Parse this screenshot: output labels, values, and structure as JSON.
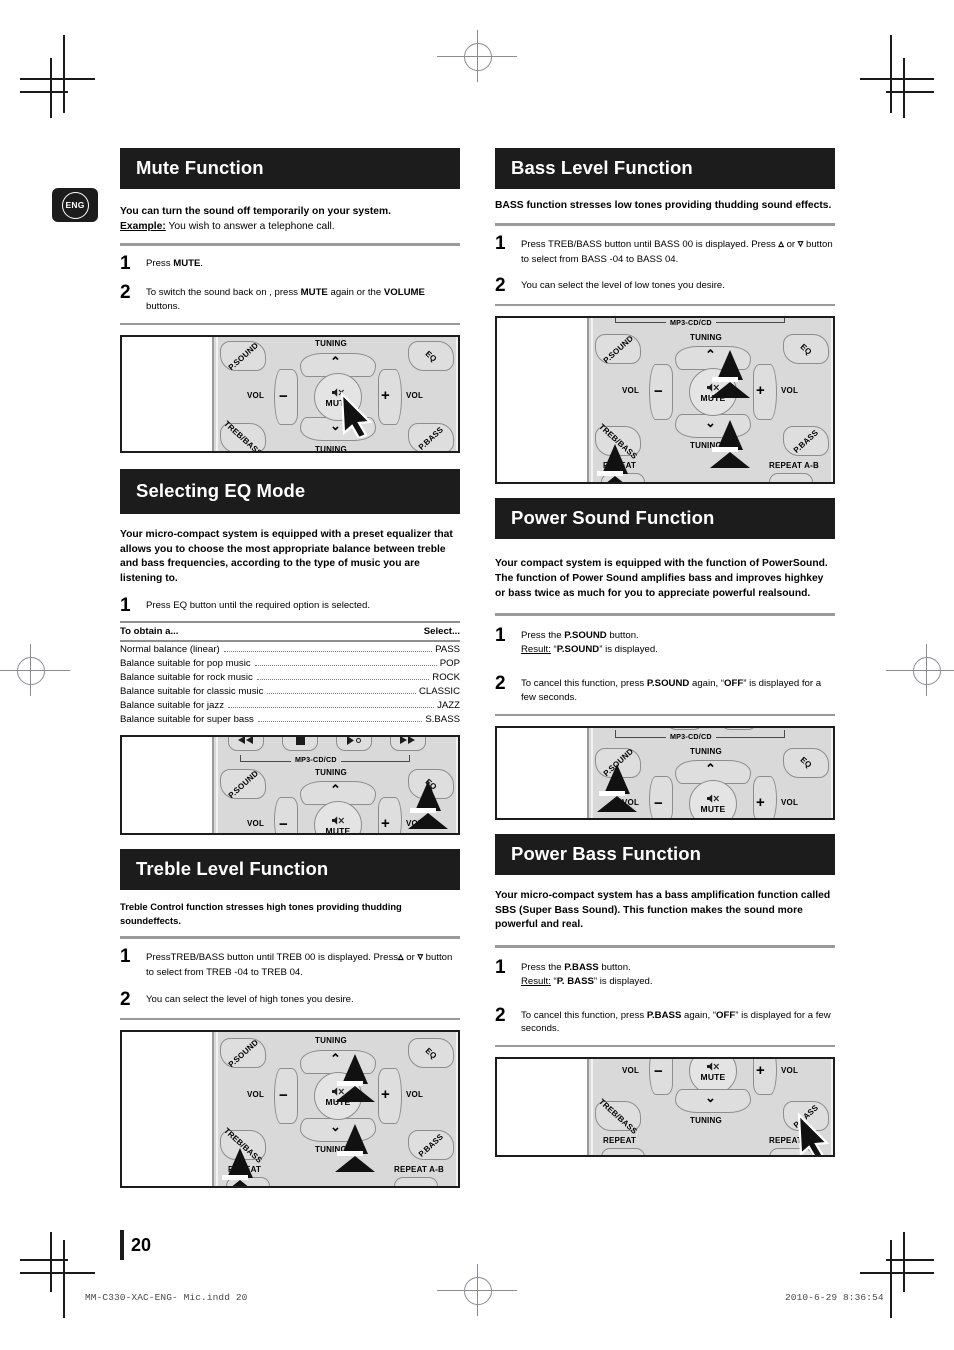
{
  "page": {
    "language_tab": "ENG",
    "number": "20",
    "footer_left": "MM-C330-XAC-ENG- Mic.indd   20",
    "footer_right": "2010-6-29   8:36:54"
  },
  "sections": {
    "mute": {
      "title": "Mute Function",
      "intro_bold": "You can turn the sound off temporarily on your system.",
      "example_label": "Example:",
      "example_text": " You wish to answer a telephone call.",
      "steps": [
        {
          "num": "1",
          "html": "Press <b>MUTE</b>."
        },
        {
          "num": "2",
          "html": "To switch the sound back on , press <b>MUTE</b> again or the <b>VOLUME</b> buttons."
        }
      ]
    },
    "eq": {
      "title": "Selecting  EQ Mode",
      "intro_bold": "Your micro-compact system is equipped with a preset equalizer that allows you to choose the most appropriate balance between treble and bass frequencies, according to the type of music you are listening to.",
      "steps": [
        {
          "num": "1",
          "html": "Press EQ button until the required option is selected."
        }
      ],
      "table": {
        "header": {
          "left": "To obtain a...",
          "right": "Select..."
        },
        "rows": [
          {
            "label": "Normal balance (linear)",
            "value": "PASS"
          },
          {
            "label": "Balance suitable for pop music",
            "value": "POP"
          },
          {
            "label": "Balance suitable for rock music",
            "value": "ROCK"
          },
          {
            "label": "Balance suitable for classic music",
            "value": "CLASSIC"
          },
          {
            "label": "Balance suitable for jazz",
            "value": "JAZZ"
          },
          {
            "label": "Balance suitable for super bass",
            "value": "S.BASS"
          }
        ]
      }
    },
    "treble": {
      "title": "Treble Level Function",
      "intro_bold": "Treble Control function stresses high tones providing thudding soundeffects.",
      "steps": [
        {
          "num": "1",
          "html": "PressTREB/BASS  button until TREB 00 is displayed. Press<span class=\"caret\">&#9653;</span> or <span class=\"caret\">&#9663;</span> button to select from TREB -04 to TREB 04."
        },
        {
          "num": "2",
          "html": "You can select the level of high tones you desire."
        }
      ]
    },
    "bass": {
      "title": "Bass Level Function",
      "intro_bold": "BASS function stresses low tones providing thudding sound effects.",
      "steps": [
        {
          "num": "1",
          "html": "Press TREB/BASS  button until  BASS 00 is displayed.  Press <span class=\"caret\">&#9653;</span> or <span class=\"caret\">&#9663;</span> button to select from BASS -04 to BASS  04."
        },
        {
          "num": "2",
          "html": "You can select the level of low tones you desire."
        }
      ]
    },
    "psound": {
      "title": "Power Sound Function",
      "intro_bold": "Your compact system is equipped with the function of PowerSound.\nThe function of Power Sound amplifies bass and improves highkey or bass twice as much for you to appreciate powerful realsound.",
      "steps": [
        {
          "num": "1",
          "html": "Press the <b>P.SOUND</b> button.<br><span class=\"u\">Result:</span> “<b>P.SOUND</b>” is displayed."
        },
        {
          "num": "2",
          "html": "To cancel this function, press <b>P.SOUND</b> again, “<b>OFF</b>” is displayed for a few seconds."
        }
      ]
    },
    "pbass": {
      "title": "Power Bass Function",
      "intro_bold": "Your micro-compact system has a bass amplification function called SBS (Super Bass Sound). This function makes the sound more powerful and real.",
      "steps": [
        {
          "num": "1",
          "html": "Press the <b>P.BASS</b> button.<br><span class=\"u\">Result:</span> “<b>P. BASS</b>” is displayed."
        },
        {
          "num": "2",
          "html": "To cancel this function, press <b>P.BASS</b> again, “<b>OFF</b>” is displayed  for a few seconds."
        }
      ]
    }
  },
  "remote_labels": {
    "psound": "P.SOUND",
    "eq": "EQ",
    "treb_bass": "TREB/BASS",
    "pbass": "P.BASS",
    "tuning": "TUNING",
    "vol": "VOL",
    "mute": "MUTE",
    "minus": "−",
    "plus": "+",
    "mp3_cd": "MP3-CD/CD",
    "repeat": "REPEAT",
    "repeat_ab": "REPEAT A-B",
    "chev_up": "⌃",
    "chev_down": "⌄"
  }
}
